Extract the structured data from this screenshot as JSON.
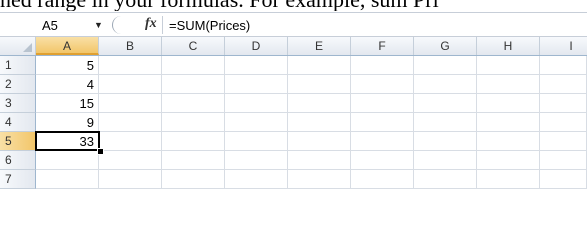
{
  "context_text": "ned range in your formulas. For example, sum Pri",
  "formula_bar": {
    "name_box": "A5",
    "fx_label": "fx",
    "formula": "=SUM(Prices)"
  },
  "columns": [
    "A",
    "B",
    "C",
    "D",
    "E",
    "F",
    "G",
    "H",
    "I"
  ],
  "rows": [
    {
      "num": "1",
      "a": "5"
    },
    {
      "num": "2",
      "a": "4"
    },
    {
      "num": "3",
      "a": "15"
    },
    {
      "num": "4",
      "a": "9"
    },
    {
      "num": "5",
      "a": "33"
    },
    {
      "num": "6",
      "a": ""
    },
    {
      "num": "7",
      "a": ""
    }
  ],
  "active_cell": "A5"
}
